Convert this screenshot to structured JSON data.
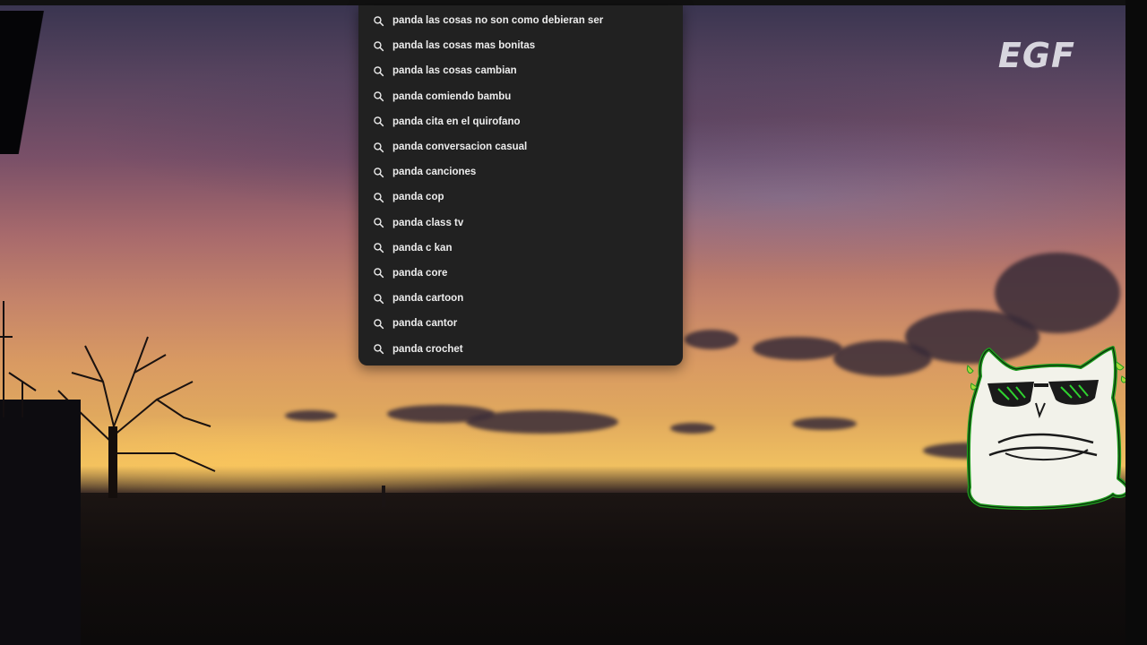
{
  "watermark": {
    "text": "EGF"
  },
  "search": {
    "suggestions": [
      {
        "label": "panda las cosas no son como debieran ser",
        "icon": "search-icon"
      },
      {
        "label": "panda las cosas mas bonitas",
        "icon": "search-icon"
      },
      {
        "label": "panda las cosas cambian",
        "icon": "search-icon"
      },
      {
        "label": "panda comiendo bambu",
        "icon": "search-icon"
      },
      {
        "label": "panda cita en el quirofano",
        "icon": "search-icon"
      },
      {
        "label": "panda conversacion casual",
        "icon": "search-icon"
      },
      {
        "label": "panda canciones",
        "icon": "search-icon"
      },
      {
        "label": "panda cop",
        "icon": "search-icon"
      },
      {
        "label": "panda class tv",
        "icon": "search-icon"
      },
      {
        "label": "panda c kan",
        "icon": "search-icon"
      },
      {
        "label": "panda core",
        "icon": "search-icon"
      },
      {
        "label": "panda cartoon",
        "icon": "search-icon"
      },
      {
        "label": "panda cantor",
        "icon": "search-icon"
      },
      {
        "label": "panda crochet",
        "icon": "search-icon"
      }
    ]
  },
  "colors": {
    "dropdown_bg": "#212121",
    "suggestion_text": "#ececec",
    "mascot_outline": "#1f9c1f"
  }
}
